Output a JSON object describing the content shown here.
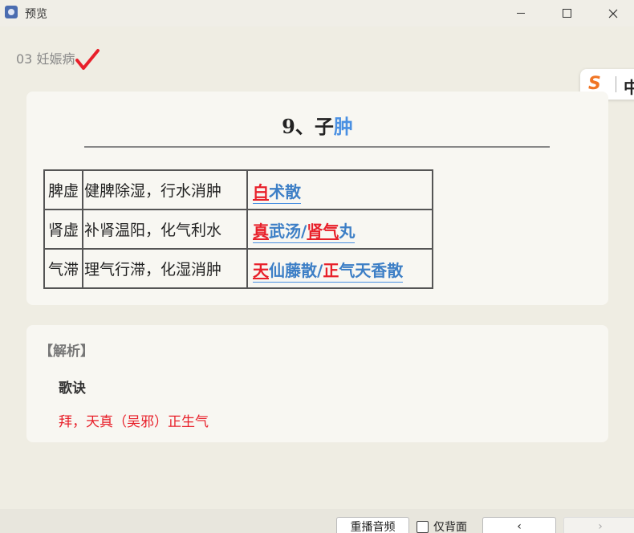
{
  "window": {
    "title": "预览"
  },
  "header": {
    "chapter": "03 妊娠病"
  },
  "ime": {
    "logo": "S",
    "mode": "中"
  },
  "main": {
    "title_prefix": "9、子",
    "title_highlight": "肿",
    "rows": [
      {
        "type": "脾虚",
        "method": "健脾除湿，行水消肿",
        "formula": [
          {
            "t": "白",
            "style": "red-u"
          },
          {
            "t": "术散",
            "style": "bl"
          }
        ]
      },
      {
        "type": "肾虚",
        "method": "补肾温阳，化气利水",
        "formula": [
          {
            "t": "真",
            "style": "red-u"
          },
          {
            "t": "武汤/",
            "style": "bl"
          },
          {
            "t": "肾气",
            "style": "red-u"
          },
          {
            "t": "丸",
            "style": "bl"
          }
        ]
      },
      {
        "type": "气滞",
        "method": "理气行滞，化湿消肿",
        "formula": [
          {
            "t": "天",
            "style": "red-u"
          },
          {
            "t": "仙藤散/",
            "style": "bl"
          },
          {
            "t": "正",
            "style": "red"
          },
          {
            "t": "气天香散",
            "style": "bl"
          }
        ]
      }
    ]
  },
  "analysis": {
    "heading": "【解析】",
    "subheading": "歌诀",
    "mnemonic": "拜，天真（吴邪）正生气"
  },
  "bottom": {
    "replay_label": "重播音频",
    "back_only_label": "仅背面",
    "prev_symbol": "‹",
    "next_symbol": "›"
  },
  "colors": {
    "accent_blue": "#4a90e2",
    "accent_red": "#e8202a",
    "background": "#efede3"
  }
}
